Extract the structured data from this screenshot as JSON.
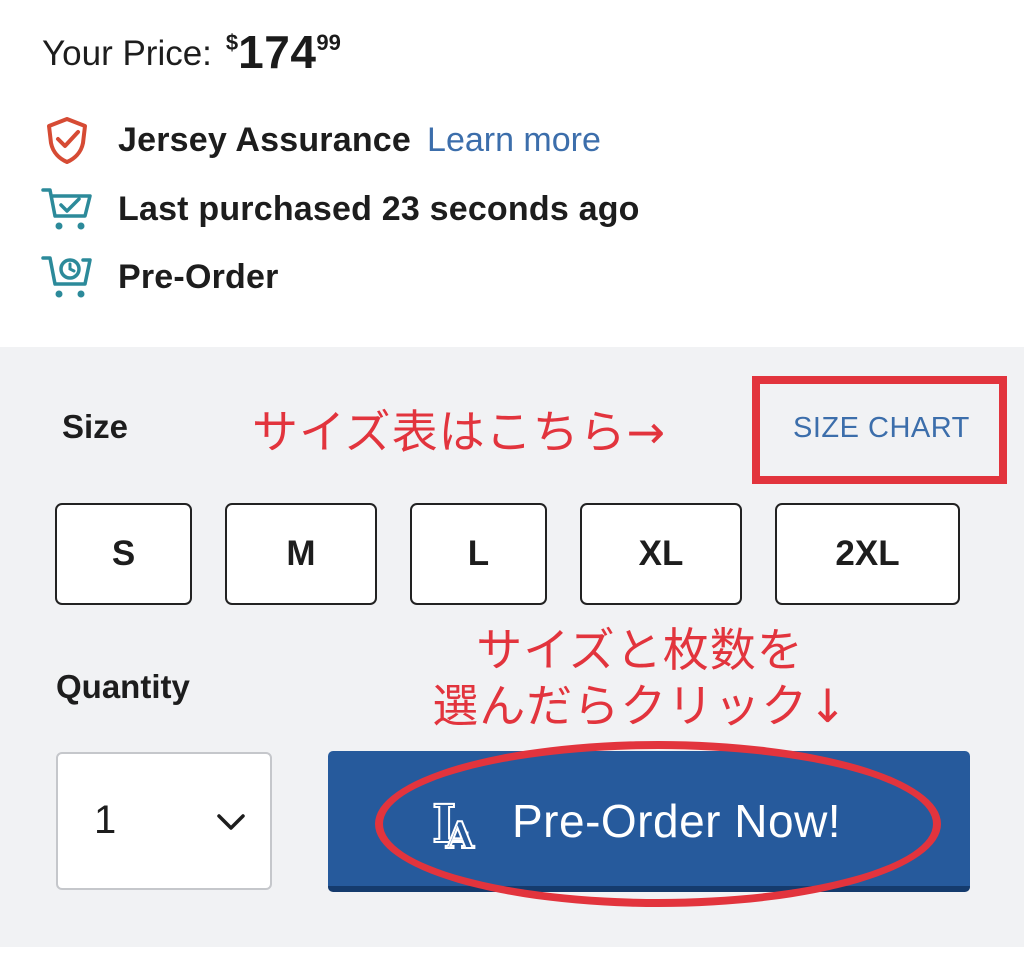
{
  "price": {
    "label": "Your Price:",
    "currency": "$",
    "dollars": "174",
    "cents": "99"
  },
  "features": {
    "assurance": {
      "label": "Jersey Assurance",
      "link": "Learn more",
      "icon": "shield-check-icon"
    },
    "last_purchased": {
      "label": "Last purchased 23 seconds ago",
      "icon": "cart-check-icon"
    },
    "preorder": {
      "label": "Pre-Order",
      "icon": "cart-clock-icon"
    }
  },
  "size": {
    "label": "Size",
    "chart_link": "SIZE CHART",
    "options": [
      "S",
      "M",
      "L",
      "XL",
      "2XL"
    ]
  },
  "quantity": {
    "label": "Quantity",
    "value": "1"
  },
  "order_button": {
    "label": "Pre-Order Now!",
    "logo": "LA"
  },
  "annotations": {
    "size_chart_note": "サイズ表はこちら→",
    "order_note_line1": "サイズと枚数を",
    "order_note_line2": "選んだらクリック↓"
  },
  "colors": {
    "accent_blue": "#265a9c",
    "link_blue": "#3c6eab",
    "annotation_red": "#e2343d",
    "icon_teal": "#2c8a9a"
  }
}
